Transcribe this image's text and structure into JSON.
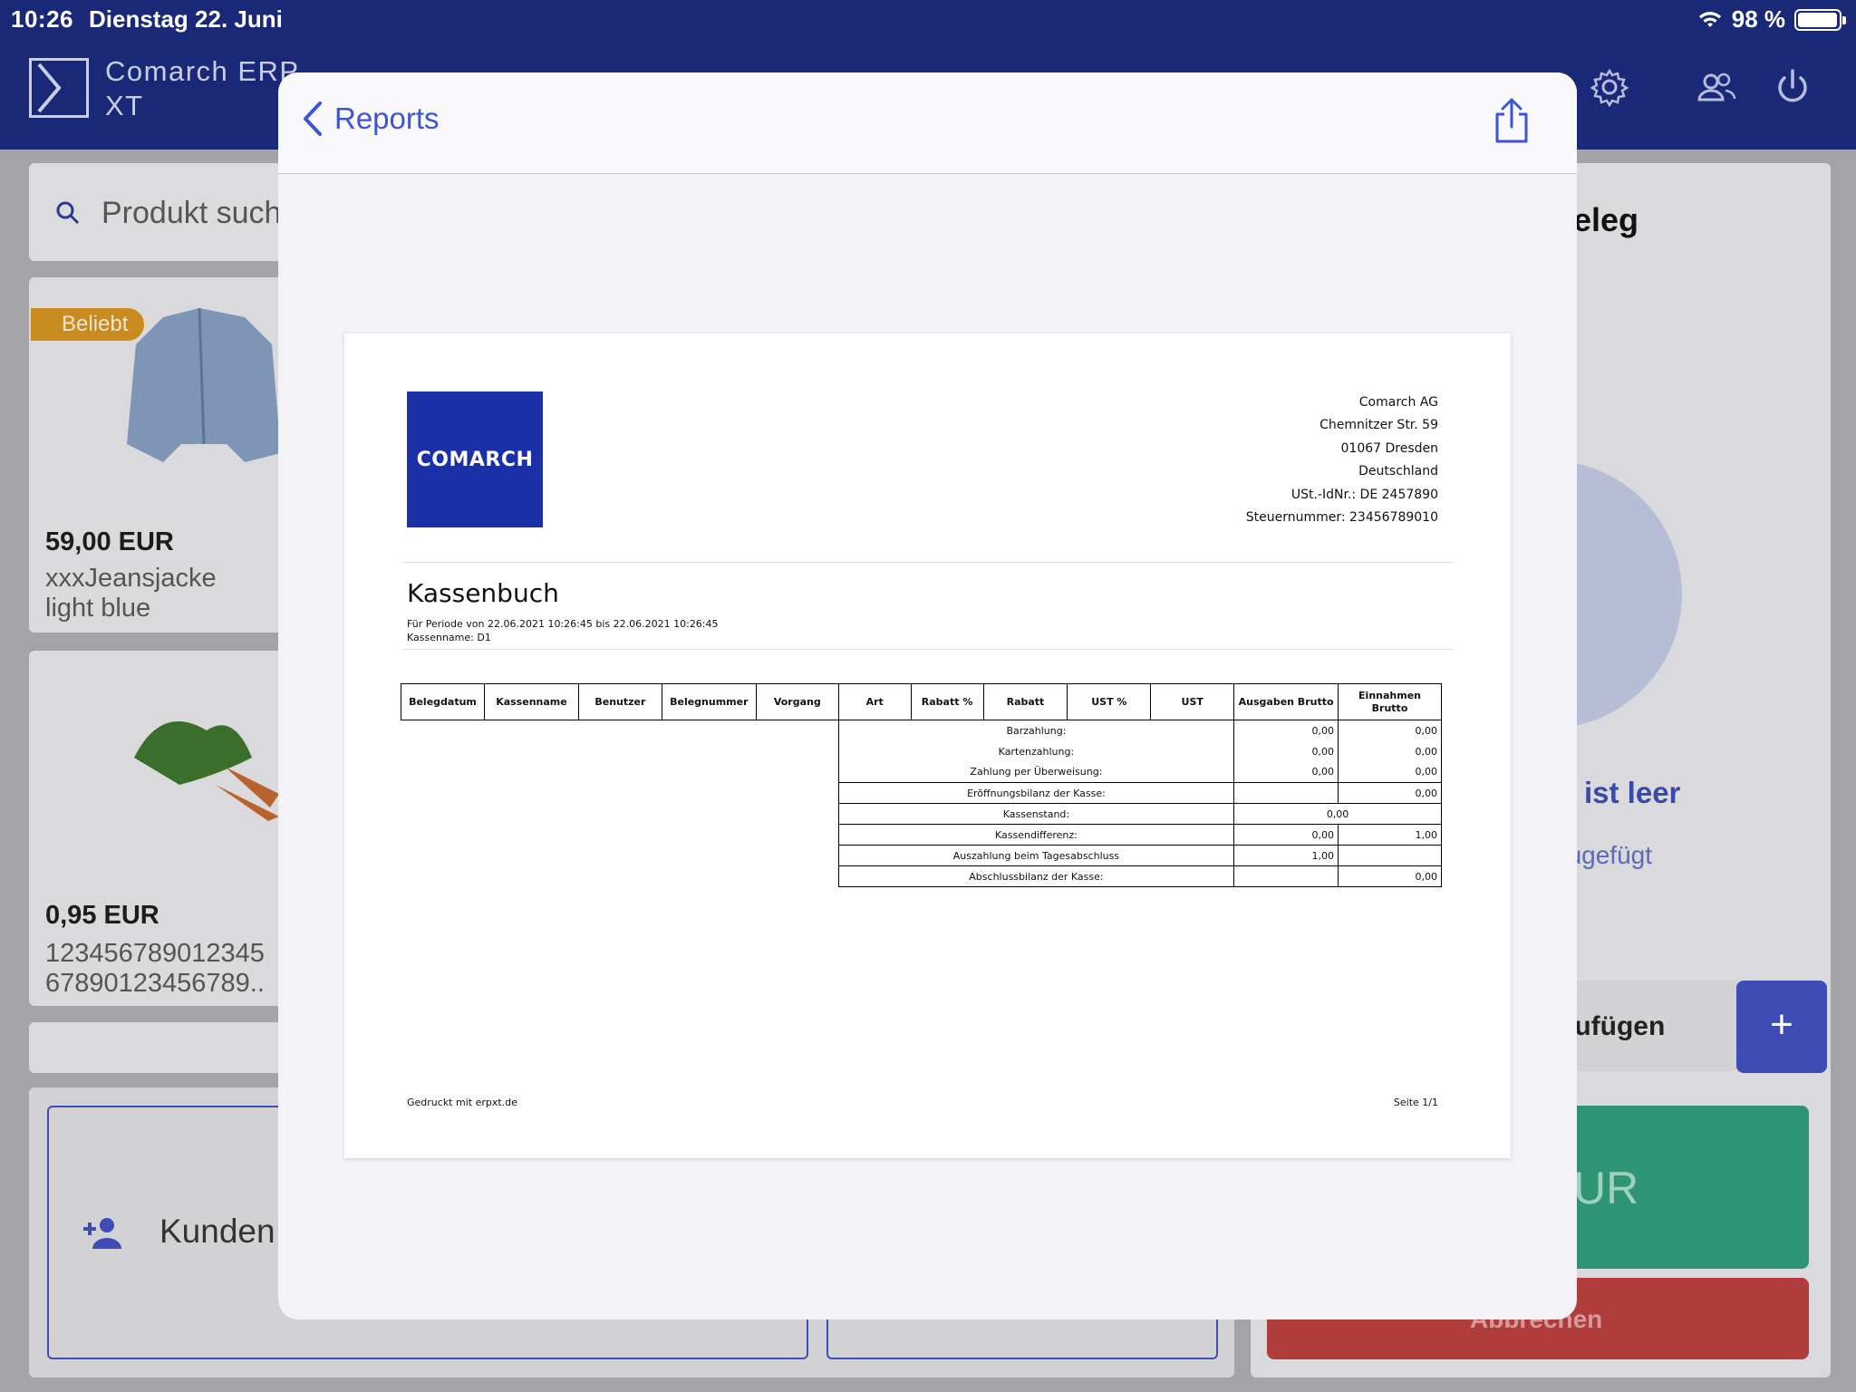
{
  "status_bar": {
    "time": "10:26",
    "date": "Dienstag 22. Juni",
    "battery": "98 %",
    "battery_level": 0.98
  },
  "app": {
    "name_line1": "Comarch ERP",
    "name_line2": "XT"
  },
  "background": {
    "search_placeholder": "Produkt such",
    "products": [
      {
        "badge": "Beliebt",
        "price": "59,00 EUR",
        "name_line1": "xxxJeansjacke",
        "name_line2": "light blue"
      },
      {
        "price": "0,95 EUR",
        "name_line1": "123456789012345",
        "name_line2": "67890123456789.."
      }
    ],
    "receipt_title": "eleg",
    "empty_title": "ist leer",
    "empty_hint": "nzugefügt",
    "add_label": "nzufügen",
    "add_button": "+",
    "pay_label": "UR",
    "cancel_label": "Abbrechen",
    "customer_label": "Kunden"
  },
  "modal": {
    "back_label": "Reports"
  },
  "document": {
    "logo_text": "COMARCH",
    "company": {
      "name": "Comarch AG",
      "street": "Chemnitzer Str. 59",
      "city": "01067 Dresden",
      "country": "Deutschland",
      "vat": "USt.-IdNr.: DE 2457890",
      "tax": "Steuernummer: 23456789010"
    },
    "title": "Kassenbuch",
    "period": "Für Periode von 22.06.2021 10:26:45 bis 22.06.2021 10:26:45",
    "register": "Kassenname: D1",
    "columns": [
      "Belegdatum",
      "Kassenname",
      "Benutzer",
      "Belegnummer",
      "Vorgang",
      "Art",
      "Rabatt %",
      "Rabatt",
      "UST %",
      "UST",
      "Ausgaben Brutto",
      "Einnahmen Brutto"
    ],
    "summary": [
      {
        "label": "Barzahlung:",
        "ausgaben": "0,00",
        "einnahmen": "0,00"
      },
      {
        "label": "Kartenzahlung:",
        "ausgaben": "0,00",
        "einnahmen": "0,00"
      },
      {
        "label": "Zahlung per Überweisung:",
        "ausgaben": "0,00",
        "einnahmen": "0,00"
      },
      {
        "label": "Eröffnungsbilanz der Kasse:",
        "ausgaben": "",
        "einnahmen": "0,00"
      },
      {
        "label": "Kassenstand:",
        "combined": "0,00"
      },
      {
        "label": "Kassendifferenz:",
        "ausgaben": "0,00",
        "einnahmen": "1,00"
      },
      {
        "label": "Auszahlung beim Tagesabschluss",
        "ausgaben": "1,00",
        "einnahmen": ""
      },
      {
        "label": "Abschlussbilanz der Kasse:",
        "ausgaben": "",
        "einnahmen": "0,00"
      }
    ],
    "footer_left": "Gedruckt mit erpxt.de",
    "footer_right": "Seite 1/1"
  },
  "colors": {
    "header": "#1a2878",
    "accent": "#3c55d0",
    "logo": "#1b2fa6",
    "pay": "#2f9474",
    "cancel": "#b13c3c"
  }
}
